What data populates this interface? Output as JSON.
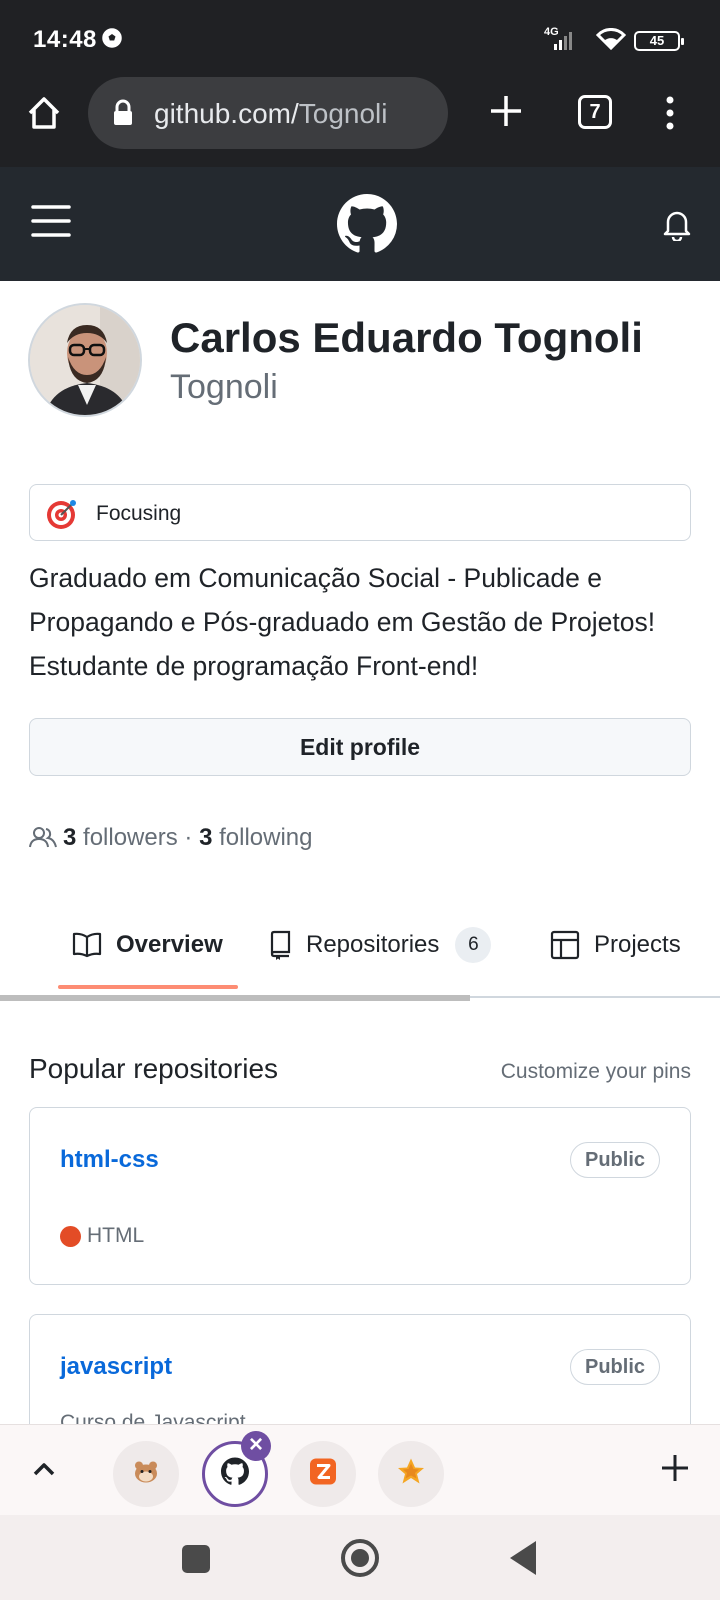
{
  "status_bar": {
    "time": "14:48",
    "network": "4G",
    "battery": "45"
  },
  "browser": {
    "url_host": "github.com/",
    "url_path": "Tognoli",
    "tab_count": "7"
  },
  "profile": {
    "full_name": "Carlos Eduardo Tognoli",
    "username": "Tognoli",
    "status_text": "Focusing",
    "bio": "Graduado em Comunicação Social - Publicade e Propagando e Pós-graduado em Gestão de Projetos! Estudante de programação Front-end!",
    "edit_button": "Edit profile",
    "followers_count": "3",
    "followers_label": "followers",
    "separator": "·",
    "following_count": "3",
    "following_label": "following"
  },
  "tabs": [
    {
      "label": "Overview"
    },
    {
      "label": "Repositories",
      "count": "6"
    },
    {
      "label": "Projects"
    }
  ],
  "popular": {
    "title": "Popular repositories",
    "customize_link": "Customize your pins",
    "repos": [
      {
        "name": "html-css",
        "visibility": "Public",
        "language": "HTML",
        "language_color": "#e34c26"
      },
      {
        "name": "javascript",
        "visibility": "Public",
        "description": "Curso de Javascript"
      }
    ]
  },
  "tab_strip": {
    "close_label": "×"
  },
  "colors": {
    "accent_link": "#0969da",
    "tab_underline": "#fd8c73",
    "header_bg": "#24292f",
    "browser_bg": "#202124",
    "active_tab_ring": "#6f4ea2"
  }
}
